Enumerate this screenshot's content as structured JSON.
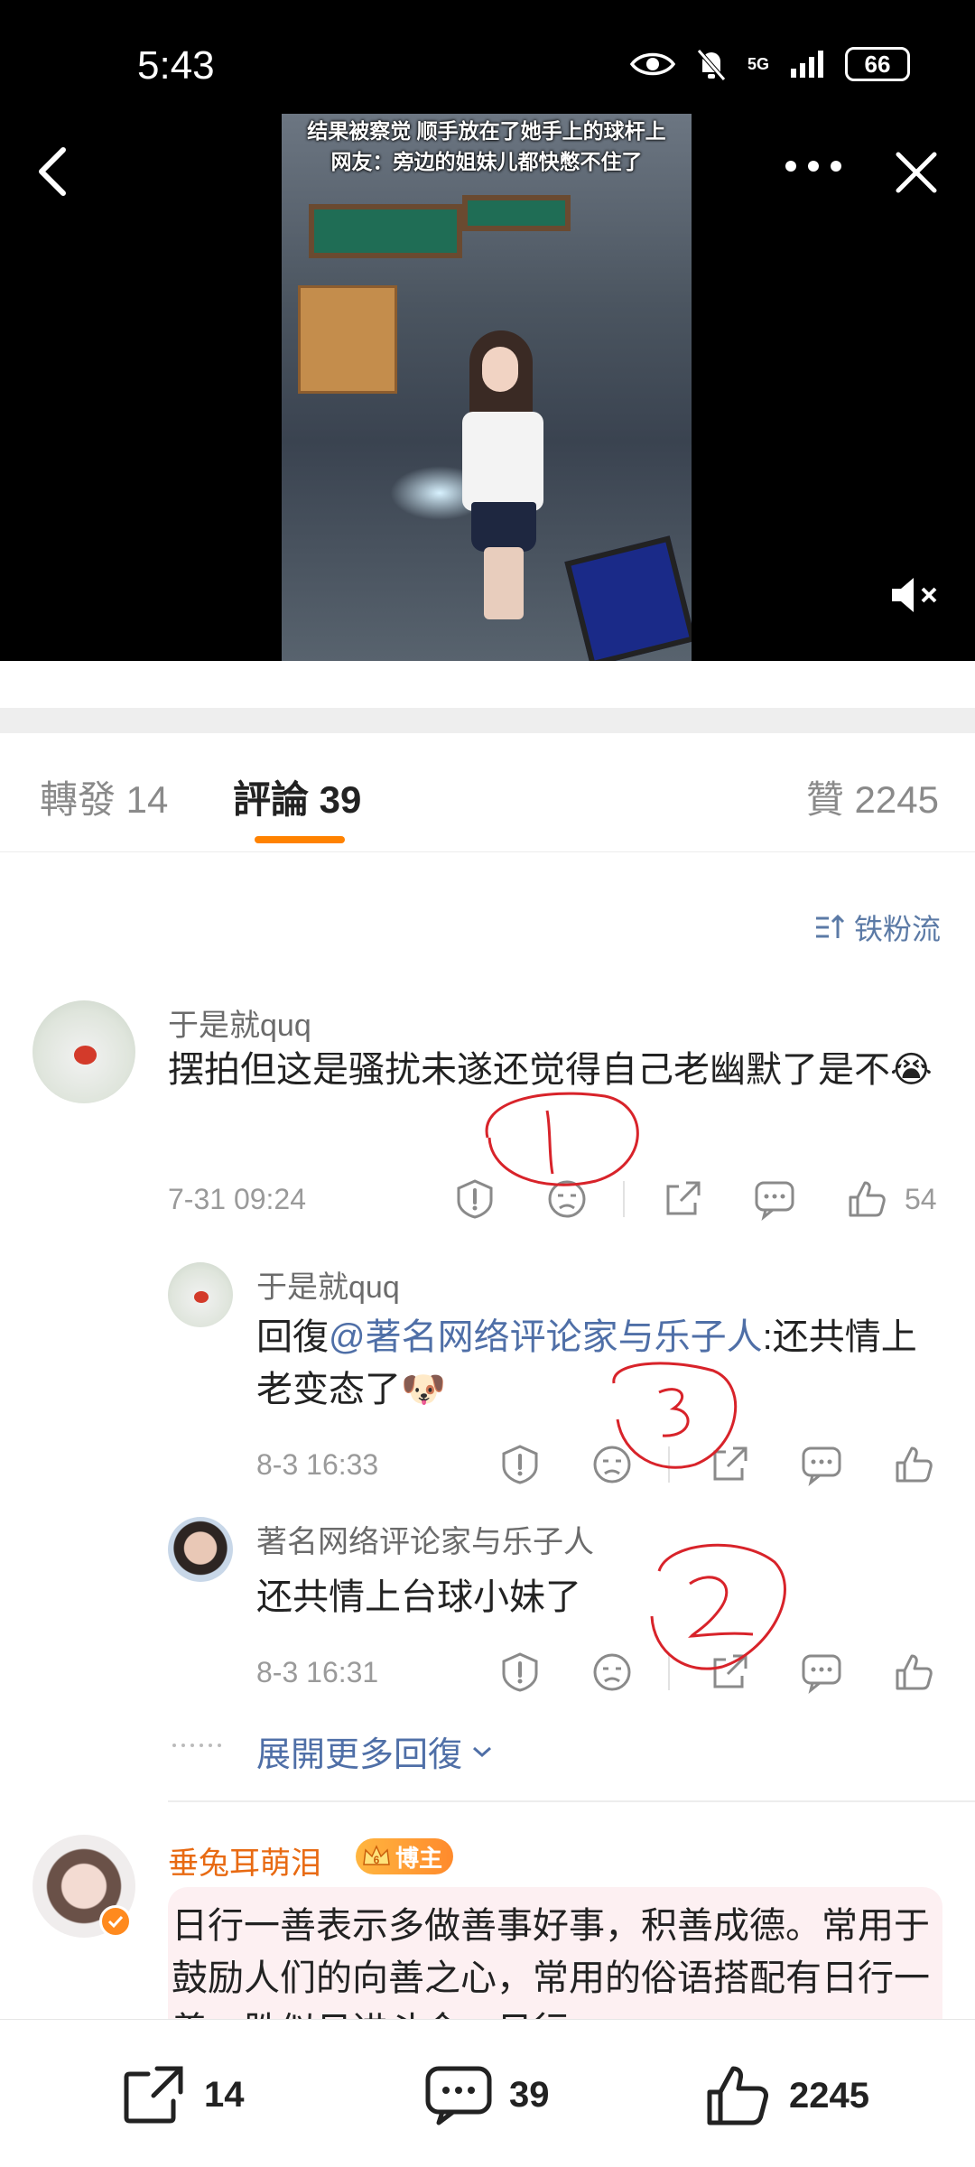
{
  "status_bar": {
    "time": "5:43",
    "network": "5G",
    "battery": "66"
  },
  "video": {
    "caption_line1": "结果被察觉 顺手放在了她手上的球杆上",
    "caption_line2": "网友：旁边的姐妹儿都快憋不住了"
  },
  "tabs": {
    "repost": "轉發 14",
    "comment": "評論 39",
    "like": "贊 2245"
  },
  "sort_toggle": "铁粉流",
  "comments": [
    {
      "username": "于是就quq",
      "text": "摆拍但这是骚扰未遂还觉得自己老幽默了是不",
      "emoji": "😭",
      "time": "7-31 09:24",
      "likes": "54"
    }
  ],
  "replies": [
    {
      "username": "于是就quq",
      "prefix": "回復",
      "mention": "@著名网络评论家与乐子人",
      "text": ":还共情上老变态了",
      "emoji": "🐶",
      "time": "8-3 16:33"
    },
    {
      "username": "著名网络评论家与乐子人",
      "text": "还共情上台球小妹了",
      "time": "8-3 16:31"
    }
  ],
  "expand_more": "展開更多回復",
  "second_comment": {
    "username": "垂兔耳萌泪",
    "badge_level": "6",
    "badge_label": "博主",
    "text": "日行一善表示多做善事好事，积善成德。常用于鼓励人们的向善之心，常用的俗语搭配有日行一善，胜似日进斗金；日行"
  },
  "bottom_bar": {
    "repost_count": "14",
    "comment_count": "39",
    "like_count": "2245"
  },
  "colors": {
    "accent": "#ff8200",
    "link": "#4f6fa7",
    "annotation_red": "#d8232a"
  }
}
